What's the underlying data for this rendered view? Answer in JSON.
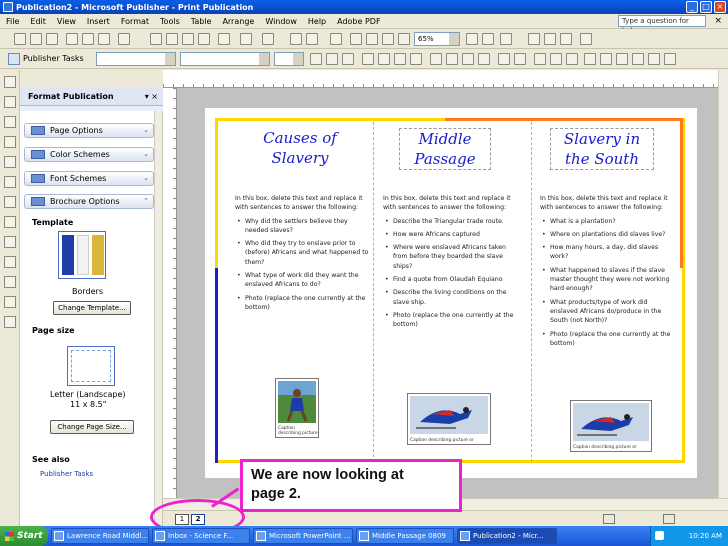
{
  "window": {
    "title": "Publication2 - Microsoft Publisher - Print Publication"
  },
  "menu": [
    "File",
    "Edit",
    "View",
    "Insert",
    "Format",
    "Tools",
    "Table",
    "Arrange",
    "Window",
    "Help",
    "Adobe PDF"
  ],
  "help_placeholder": "Type a question for help",
  "toolbar": {
    "zoom": "65%",
    "publisher_tasks": "Publisher Tasks"
  },
  "task_pane": {
    "title": "Format Publication",
    "sections": [
      "Page Options",
      "Color Schemes",
      "Font Schemes",
      "Brochure Options"
    ],
    "template_label": "Template",
    "template_name": "Borders",
    "change_template_button": "Change Template...",
    "page_size_label": "Page size",
    "page_size_name": "Letter (Landscape)",
    "page_size_dims": "11 x 8.5\"",
    "change_page_size_button": "Change Page Size...",
    "see_also_label": "See also",
    "see_also_link": "Publisher Tasks"
  },
  "brochure": {
    "intro": "In this box, delete this text and replace it with sentences to answer the following:",
    "panels": [
      {
        "title_line1": "Causes of",
        "title_line2": "Slavery",
        "bullets": [
          "Why did the settlers believe they needed slaves?",
          "Who did they try to enslave prior to (before) Africans and what happened to them?",
          "What type of work did they want the enslaved Africans to do?",
          "Photo (replace the one currently at the bottom)"
        ],
        "photo_caption": "Caption describing picture"
      },
      {
        "title_line1": "Middle",
        "title_line2": "Passage",
        "bullets": [
          "Describe the Triangular trade route.",
          "How were Africans captured",
          "Where were enslaved Africans taken from before they boarded the slave ships?",
          "Find a quote from Olaudah Equiano",
          "Describe the living conditions on the slave ship.",
          "Photo (replace the one currently at the bottom)"
        ],
        "photo_caption": "Caption describing picture or"
      },
      {
        "title_line1": "Slavery in",
        "title_line2": "the South",
        "bullets": [
          "What is a plantation?",
          "Where on plantations did slaves live?",
          "How many hours, a day, did slaves work?",
          "What happened to slaves if the slave master thought they were not working hard enough?",
          "What products/type of work did enslaved Africans do/produce in the South (not North)?",
          "Photo (replace the one currently at the bottom)"
        ],
        "photo_caption": "Caption describing picture or"
      }
    ]
  },
  "callout": {
    "line1": "We are now looking at",
    "line2": "page 2."
  },
  "page_nav": {
    "page1": "1",
    "page2": "2"
  },
  "taskbar": {
    "start": "Start",
    "tasks": [
      "Lawrence Road Middl...",
      "Inbox - Science F...",
      "Microsoft PowerPoint ...",
      "Middle Passage 0809",
      "Publication2 - Micr..."
    ],
    "clock": "10:20 AM"
  }
}
